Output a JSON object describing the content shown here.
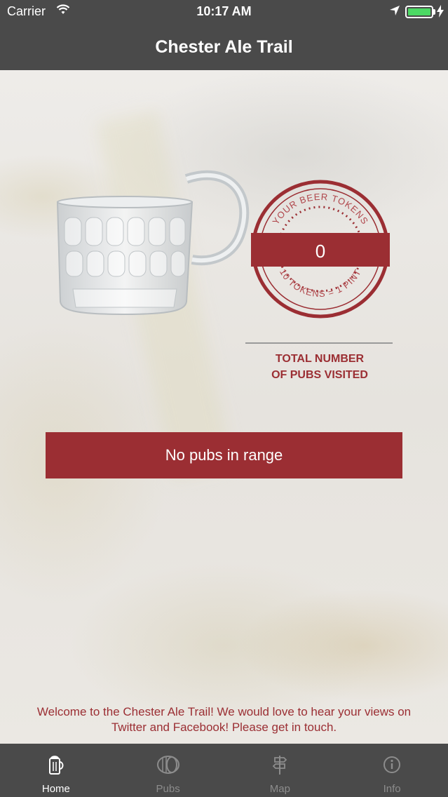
{
  "status_bar": {
    "carrier": "Carrier",
    "time": "10:17 AM"
  },
  "nav": {
    "title": "Chester Ale Trail"
  },
  "tokens": {
    "top_text": "YOUR BEER TOKENS",
    "bottom_text": "10 TOKENS = 1 PINT",
    "count": "0"
  },
  "pubs_visited": {
    "line1": "TOTAL NUMBER",
    "line2": "OF PUBS VISITED"
  },
  "range_button": {
    "label": "No pubs in range"
  },
  "welcome": {
    "text": "Welcome to the Chester Ale Trail!  We would love to hear your views on Twitter and Facebook! Please get in touch."
  },
  "tabs": [
    {
      "label": "Home",
      "icon": "mug-icon",
      "active": true
    },
    {
      "label": "Pubs",
      "icon": "barrel-icon",
      "active": false
    },
    {
      "label": "Map",
      "icon": "signpost-icon",
      "active": false
    },
    {
      "label": "Info",
      "icon": "info-icon",
      "active": false
    }
  ],
  "colors": {
    "brand": "#9b2e33",
    "bar": "#4a4a4a",
    "battery": "#4cd964"
  }
}
